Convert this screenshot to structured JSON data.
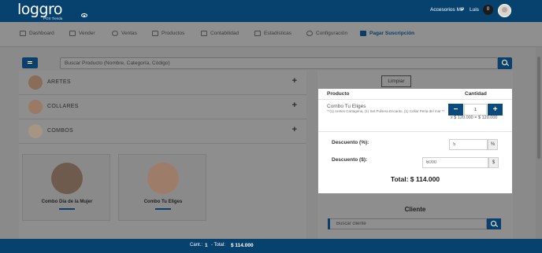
{
  "header": {
    "logo_text": "loggro",
    "logo_subtitle": "POS Tienda",
    "store_name": "Accesorios MP",
    "user_name": "Luis",
    "notifications": "0"
  },
  "nav": {
    "items": [
      {
        "label": "Dashboard",
        "icon": "dashboard-icon"
      },
      {
        "label": "Vender",
        "icon": "cart-icon"
      },
      {
        "label": "Ventas",
        "icon": "sales-icon"
      },
      {
        "label": "Productos",
        "icon": "products-icon"
      },
      {
        "label": "Contabilidad",
        "icon": "accounting-icon"
      },
      {
        "label": "Estadísticas",
        "icon": "stats-icon"
      },
      {
        "label": "Configuración",
        "icon": "settings-icon"
      }
    ],
    "subscription_label": "Pagar Suscripción"
  },
  "search": {
    "placeholder": "Buscar Producto (Nombre, Categoría, Código)"
  },
  "categories": [
    {
      "label": "ARETES"
    },
    {
      "label": "COLLARES"
    },
    {
      "label": "COMBOS"
    }
  ],
  "products": [
    {
      "name": "Combo Día de la Mujer"
    },
    {
      "name": "Combo Tu Eliges"
    }
  ],
  "cart": {
    "clear_label": "Limpiar",
    "col_product": "Producto",
    "col_quantity": "Cantidad",
    "item_name": "Combo Tu Eliges",
    "item_description": "**(1) Aretes Cartagena, (1) Set Pulsera Encanto, (1) Collar Perla del mar **",
    "item_quantity": "1",
    "item_line_total": "x $ 120.000 = $ 120.000",
    "discount_percent_label": "Descuento (%):",
    "discount_percent_value": "5",
    "discount_percent_suffix": "%",
    "discount_amount_label": "Descuento ($):",
    "discount_amount_value": "6000",
    "discount_amount_suffix": "$",
    "total_label": "Total: $ 114.000"
  },
  "client": {
    "title": "Cliente",
    "placeholder": "Buscar cliente"
  },
  "footer": {
    "count_label": "Cant.:",
    "count_value": "1",
    "total_label": "- Total:",
    "total_value": "$ 114.000"
  },
  "colors": {
    "brand": "#07426f",
    "accent_button": "#0b4a7d"
  }
}
